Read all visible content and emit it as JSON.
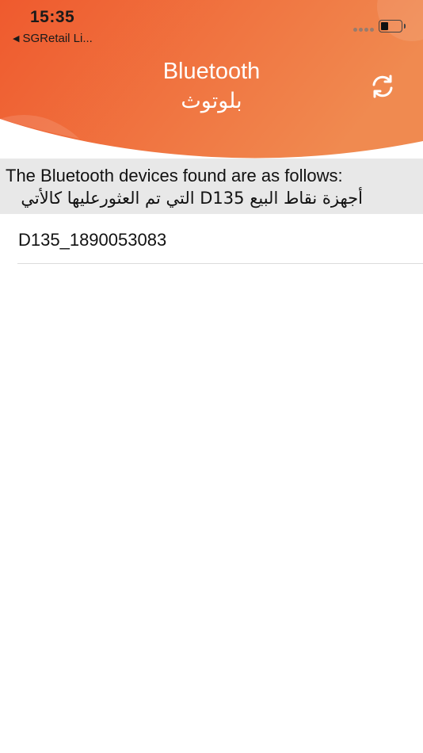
{
  "status_bar": {
    "time": "15:35",
    "back_app_label": "SGRetail Li...",
    "back_arrow_glyph": "◀"
  },
  "header": {
    "title_en": "Bluetooth",
    "title_ar": "بلوتوث",
    "refresh_icon": "refresh-icon",
    "gradient_left": "#ef5a2e",
    "gradient_right": "#f08a50"
  },
  "info": {
    "line_en": "The Bluetooth devices found are as follows:",
    "line_ar": "أجهزة نقاط البيع D135  التي تم العثورعليها كالأتي"
  },
  "devices": [
    {
      "name": "D135_1890053083"
    }
  ]
}
